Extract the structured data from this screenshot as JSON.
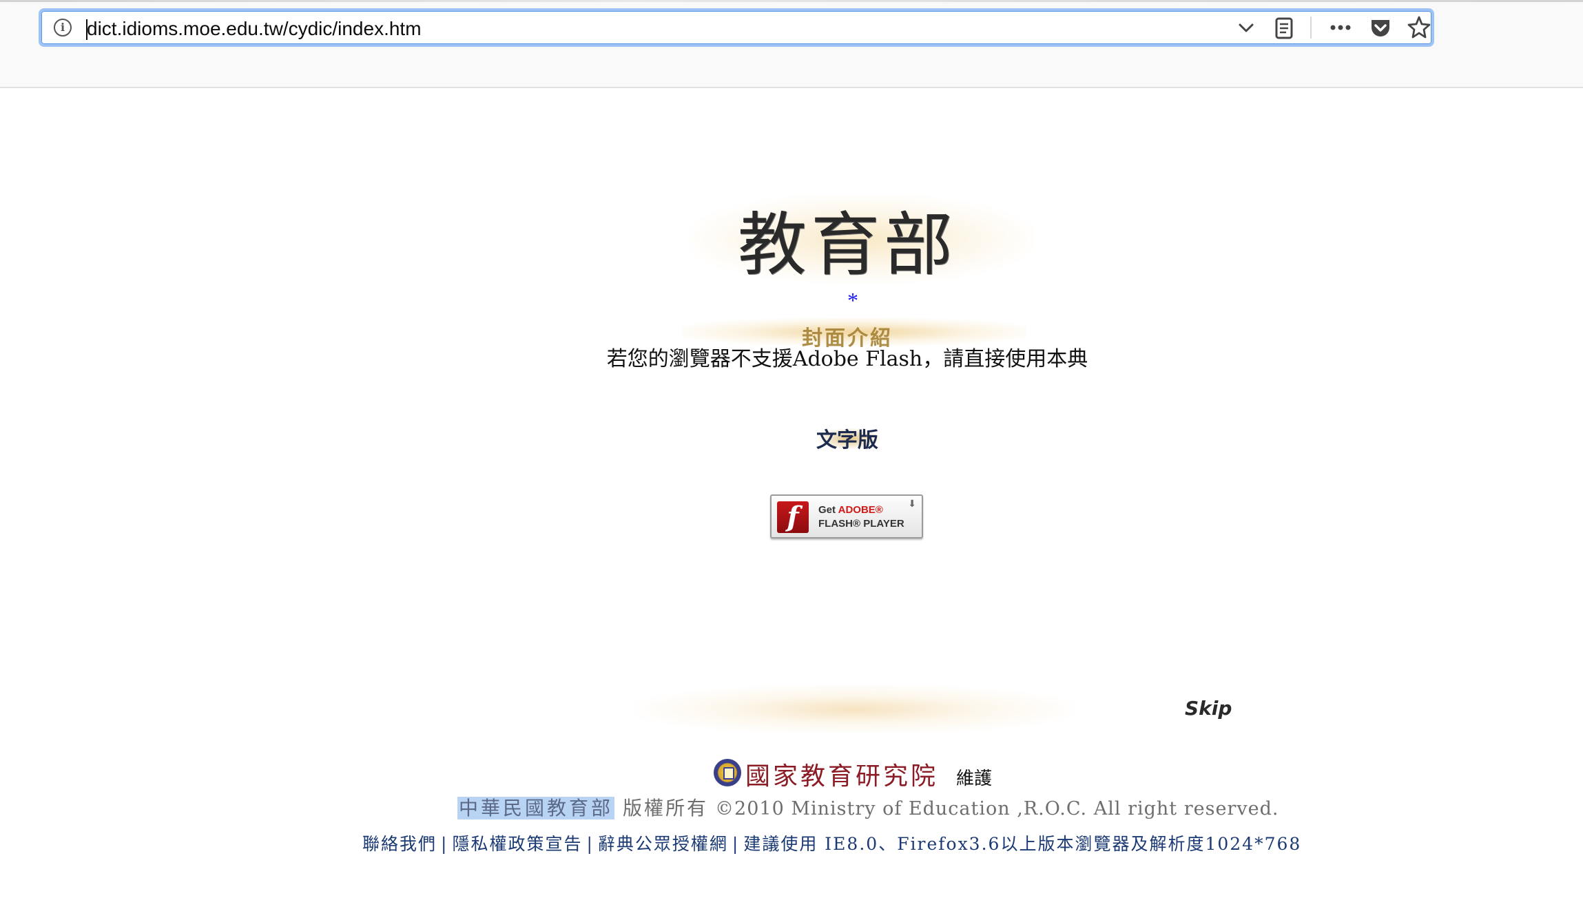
{
  "browser": {
    "url": "dict.idioms.moe.edu.tw/cydic/index.htm",
    "icons": [
      "info-icon",
      "chevron-down-icon",
      "reader-view-icon",
      "more-icon",
      "pocket-icon",
      "bookmark-star-icon"
    ]
  },
  "page": {
    "logo_text": "教育部",
    "asterisk": "*",
    "cover_title": "封面介紹",
    "notice": "若您的瀏覽器不支援Adobe Flash，請直接使用本典",
    "text_version_link": "文字版",
    "flash_badge": {
      "get": "Get",
      "adobe": "ADOBE®",
      "player": "FLASH® PLAYER"
    },
    "skip_link": "Skip"
  },
  "footer": {
    "institute_name": "國家教育研究院",
    "maintained_by": "維護",
    "ministry": "中華民國教育部",
    "rights_cn": "版權所有",
    "rights_en": "©2010 Ministry of Education ,R.O.C. All right reserved.",
    "links": {
      "contact": "聯絡我們",
      "privacy": "隱私權政策宣告",
      "license": "辭典公眾授權網",
      "recommend": "建議使用 IE8.0、Firefox3.6以上版本瀏覽器及解析度1024*768"
    },
    "separator": "|"
  },
  "colors": {
    "url_focus_border": "#9ec3f7",
    "link_navy": "#1b3a74",
    "institute_red": "#8b1c25",
    "highlight": "#b9d3f4",
    "asterisk_blue": "#1a1af0"
  }
}
